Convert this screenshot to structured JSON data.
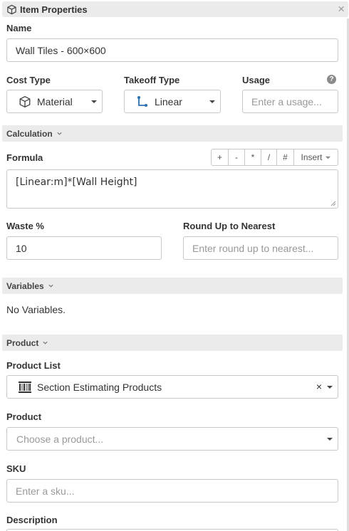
{
  "panel": {
    "title": "Item Properties",
    "close_glyph": "×"
  },
  "fields": {
    "name_label": "Name",
    "name_value": "Wall Tiles - 600×600",
    "cost_type_label": "Cost Type",
    "cost_type_value": "Material",
    "takeoff_type_label": "Takeoff Type",
    "takeoff_type_value": "Linear",
    "usage_label": "Usage",
    "usage_placeholder": "Enter a usage..."
  },
  "calculation": {
    "section_label": "Calculation",
    "formula_label": "Formula",
    "operators": [
      "+",
      "-",
      "*",
      "/",
      "#"
    ],
    "insert_label": "Insert",
    "formula_value": "[Linear:m]*[Wall Height]",
    "waste_label": "Waste %",
    "waste_value": "10",
    "round_label": "Round Up to Nearest",
    "round_placeholder": "Enter round up to nearest..."
  },
  "variables": {
    "section_label": "Variables",
    "empty_text": "No Variables."
  },
  "product": {
    "section_label": "Product",
    "list_label": "Product List",
    "list_value": "Section Estimating Products",
    "clear_glyph": "×",
    "product_label": "Product",
    "product_placeholder": "Choose a product...",
    "sku_label": "SKU",
    "sku_placeholder": "Enter a sku...",
    "description_label": "Description"
  },
  "icons": {
    "title": "cube-icon",
    "cost_type": "cube-icon",
    "takeoff_type": "linear-path-icon",
    "product_list": "barcode-icon",
    "help": "help-icon"
  }
}
